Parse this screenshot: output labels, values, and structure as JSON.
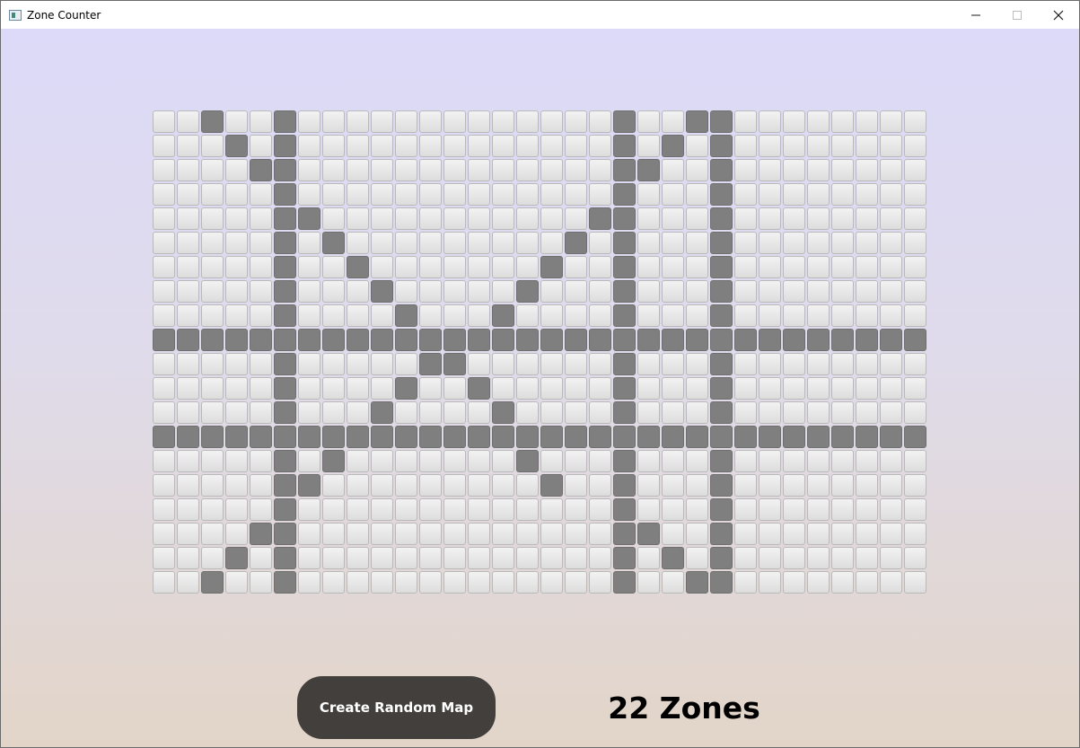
{
  "window": {
    "title": "Zone Counter",
    "controls": [
      "minimize",
      "maximize",
      "close"
    ]
  },
  "grid": {
    "rows": 20,
    "cols": 32,
    "filled": [
      "00100100000000000001001100000000",
      "00010100000000000001010100000000",
      "00001100000000000001100100000000",
      "00000100000000000001000100000000",
      "00000110000000000011000100000000",
      "00000101000000000101000100000000",
      "00000100100000001001000100000000",
      "00000100010000010001000100000000",
      "00000100001000100001000100000000",
      "11111111111111111111111111111111",
      "00000100000110000001000100000000",
      "00000100001001000001000100000000",
      "00000100010000100001000100000000",
      "11111111111111111111111111111111",
      "00000101000000010001000100000000",
      "00000110000000001001000100000000",
      "00000100000000000001000100000000",
      "00001100000000000001100100000000",
      "00010100000000000001010100000000",
      "00100100000000000001001100000000"
    ],
    "colors": {
      "filled": "#7f7f7f",
      "empty": "#e9e9e9"
    }
  },
  "controls": {
    "create_button_label": "Create Random Map"
  },
  "status": {
    "zones_label": "22 Zones"
  }
}
